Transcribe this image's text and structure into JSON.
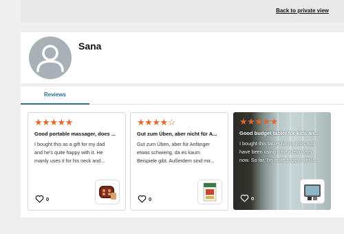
{
  "header": {
    "back_link": "Back to private view"
  },
  "profile": {
    "name": "Sana"
  },
  "tabs": [
    {
      "label": "Reviews"
    }
  ],
  "reviews": [
    {
      "rating": 5,
      "title": "Good portable massager, does ...",
      "text": [
        "I bought this as a gift for my dad",
        "and he's quite happy with it. He",
        "mainly uses it for his neck and..."
      ],
      "likes": "0",
      "product_icon": "massager-product-thumbnail"
    },
    {
      "rating": 4,
      "title": "Gut zum Üben, aber nicht für A...",
      "text": [
        "Gut zum Üben, aber für Anfänger",
        "etwas schwierig, da es kaum",
        "Beispiele gibt. Außerdem sind mir..."
      ],
      "likes": "0",
      "product_icon": "book-product-thumbnail"
    },
    {
      "rating": 5,
      "title": "Good budget tablet for kids an...",
      "text": [
        "I bought this tablet for my kids and",
        "have been using it for a few days",
        "now. So far, I'm quite happy with it..."
      ],
      "likes": "0",
      "product_icon": "tablet-product-thumbnail"
    }
  ],
  "colors": {
    "star": "#e8652a",
    "tab_accent": "#2f6f8f",
    "avatar_bg": "#a8b1b6"
  }
}
